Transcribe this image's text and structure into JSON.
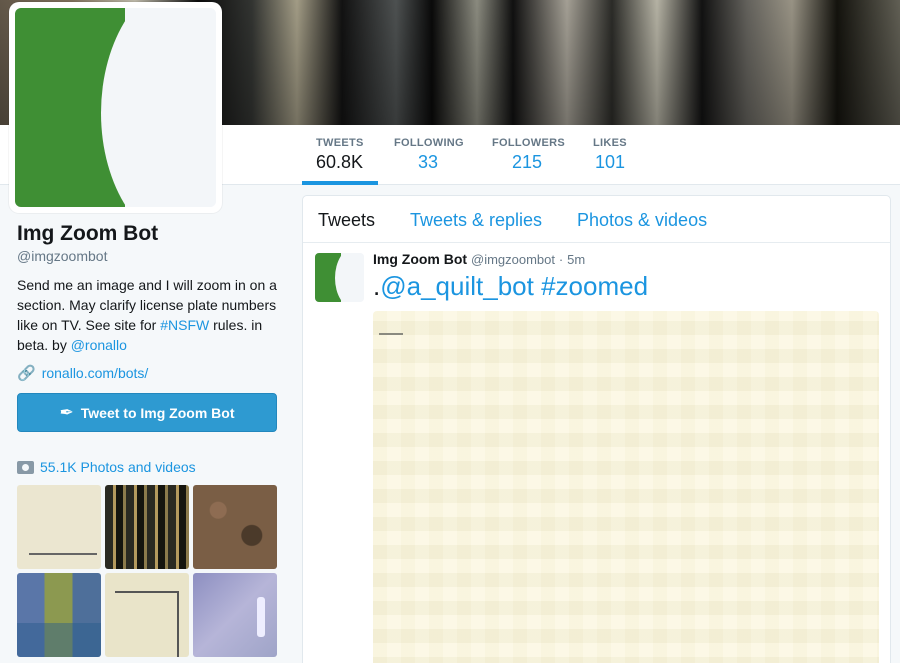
{
  "profile": {
    "name": "Img Zoom Bot",
    "handle": "@imgzoombot",
    "bio_text_1": "Send me an image and I will zoom in on a section. May clarify license plate numbers like on TV. See site for ",
    "bio_hashtag": "#NSFW",
    "bio_text_2": " rules. in beta. by ",
    "bio_mention": "@ronallo",
    "website": "ronallo.com/bots/",
    "website_icon": "link-icon",
    "tweet_button_label": "Tweet to Img Zoom Bot",
    "tweet_button_icon": "quill-icon",
    "photos_label": "55.1K Photos and videos",
    "photos_icon": "camera-icon"
  },
  "stats": [
    {
      "label": "TWEETS",
      "value": "60.8K",
      "active": true
    },
    {
      "label": "FOLLOWING",
      "value": "33"
    },
    {
      "label": "FOLLOWERS",
      "value": "215"
    },
    {
      "label": "LIKES",
      "value": "101"
    }
  ],
  "timeline": {
    "tabs": [
      {
        "label": "Tweets",
        "active": true
      },
      {
        "label": "Tweets & replies"
      },
      {
        "label": "Photos & videos"
      }
    ],
    "tweet": {
      "author_name": "Img Zoom Bot",
      "author_handle": "@imgzoombot",
      "separator": "·",
      "time": "5m",
      "text_prefix": ".",
      "mention": "@a_quilt_bot",
      "hashtag": "#zoomed"
    }
  },
  "colors": {
    "link": "#1b95e0",
    "button": "#2e9ad1",
    "avatar_green": "#3f8f34",
    "background": "#f5f8fa"
  }
}
